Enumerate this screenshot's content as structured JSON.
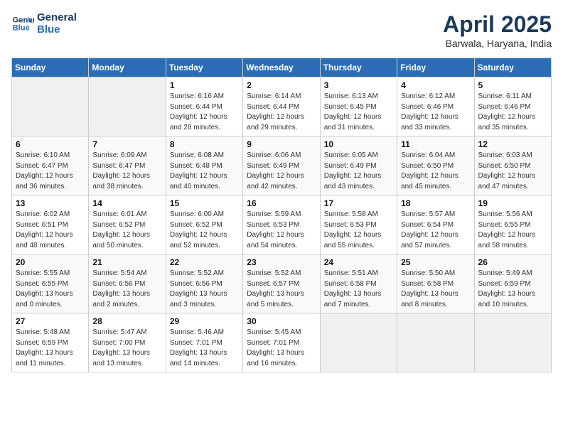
{
  "header": {
    "logo_line1": "General",
    "logo_line2": "Blue",
    "title": "April 2025",
    "subtitle": "Barwala, Haryana, India"
  },
  "calendar": {
    "days_of_week": [
      "Sunday",
      "Monday",
      "Tuesday",
      "Wednesday",
      "Thursday",
      "Friday",
      "Saturday"
    ],
    "weeks": [
      [
        {
          "num": "",
          "detail": ""
        },
        {
          "num": "",
          "detail": ""
        },
        {
          "num": "1",
          "detail": "Sunrise: 6:16 AM\nSunset: 6:44 PM\nDaylight: 12 hours\nand 28 minutes."
        },
        {
          "num": "2",
          "detail": "Sunrise: 6:14 AM\nSunset: 6:44 PM\nDaylight: 12 hours\nand 29 minutes."
        },
        {
          "num": "3",
          "detail": "Sunrise: 6:13 AM\nSunset: 6:45 PM\nDaylight: 12 hours\nand 31 minutes."
        },
        {
          "num": "4",
          "detail": "Sunrise: 6:12 AM\nSunset: 6:46 PM\nDaylight: 12 hours\nand 33 minutes."
        },
        {
          "num": "5",
          "detail": "Sunrise: 6:11 AM\nSunset: 6:46 PM\nDaylight: 12 hours\nand 35 minutes."
        }
      ],
      [
        {
          "num": "6",
          "detail": "Sunrise: 6:10 AM\nSunset: 6:47 PM\nDaylight: 12 hours\nand 36 minutes."
        },
        {
          "num": "7",
          "detail": "Sunrise: 6:09 AM\nSunset: 6:47 PM\nDaylight: 12 hours\nand 38 minutes."
        },
        {
          "num": "8",
          "detail": "Sunrise: 6:08 AM\nSunset: 6:48 PM\nDaylight: 12 hours\nand 40 minutes."
        },
        {
          "num": "9",
          "detail": "Sunrise: 6:06 AM\nSunset: 6:49 PM\nDaylight: 12 hours\nand 42 minutes."
        },
        {
          "num": "10",
          "detail": "Sunrise: 6:05 AM\nSunset: 6:49 PM\nDaylight: 12 hours\nand 43 minutes."
        },
        {
          "num": "11",
          "detail": "Sunrise: 6:04 AM\nSunset: 6:50 PM\nDaylight: 12 hours\nand 45 minutes."
        },
        {
          "num": "12",
          "detail": "Sunrise: 6:03 AM\nSunset: 6:50 PM\nDaylight: 12 hours\nand 47 minutes."
        }
      ],
      [
        {
          "num": "13",
          "detail": "Sunrise: 6:02 AM\nSunset: 6:51 PM\nDaylight: 12 hours\nand 48 minutes."
        },
        {
          "num": "14",
          "detail": "Sunrise: 6:01 AM\nSunset: 6:52 PM\nDaylight: 12 hours\nand 50 minutes."
        },
        {
          "num": "15",
          "detail": "Sunrise: 6:00 AM\nSunset: 6:52 PM\nDaylight: 12 hours\nand 52 minutes."
        },
        {
          "num": "16",
          "detail": "Sunrise: 5:59 AM\nSunset: 6:53 PM\nDaylight: 12 hours\nand 54 minutes."
        },
        {
          "num": "17",
          "detail": "Sunrise: 5:58 AM\nSunset: 6:53 PM\nDaylight: 12 hours\nand 55 minutes."
        },
        {
          "num": "18",
          "detail": "Sunrise: 5:57 AM\nSunset: 6:54 PM\nDaylight: 12 hours\nand 57 minutes."
        },
        {
          "num": "19",
          "detail": "Sunrise: 5:56 AM\nSunset: 6:55 PM\nDaylight: 12 hours\nand 58 minutes."
        }
      ],
      [
        {
          "num": "20",
          "detail": "Sunrise: 5:55 AM\nSunset: 6:55 PM\nDaylight: 13 hours\nand 0 minutes."
        },
        {
          "num": "21",
          "detail": "Sunrise: 5:54 AM\nSunset: 6:56 PM\nDaylight: 13 hours\nand 2 minutes."
        },
        {
          "num": "22",
          "detail": "Sunrise: 5:52 AM\nSunset: 6:56 PM\nDaylight: 13 hours\nand 3 minutes."
        },
        {
          "num": "23",
          "detail": "Sunrise: 5:52 AM\nSunset: 6:57 PM\nDaylight: 13 hours\nand 5 minutes."
        },
        {
          "num": "24",
          "detail": "Sunrise: 5:51 AM\nSunset: 6:58 PM\nDaylight: 13 hours\nand 7 minutes."
        },
        {
          "num": "25",
          "detail": "Sunrise: 5:50 AM\nSunset: 6:58 PM\nDaylight: 13 hours\nand 8 minutes."
        },
        {
          "num": "26",
          "detail": "Sunrise: 5:49 AM\nSunset: 6:59 PM\nDaylight: 13 hours\nand 10 minutes."
        }
      ],
      [
        {
          "num": "27",
          "detail": "Sunrise: 5:48 AM\nSunset: 6:59 PM\nDaylight: 13 hours\nand 11 minutes."
        },
        {
          "num": "28",
          "detail": "Sunrise: 5:47 AM\nSunset: 7:00 PM\nDaylight: 13 hours\nand 13 minutes."
        },
        {
          "num": "29",
          "detail": "Sunrise: 5:46 AM\nSunset: 7:01 PM\nDaylight: 13 hours\nand 14 minutes."
        },
        {
          "num": "30",
          "detail": "Sunrise: 5:45 AM\nSunset: 7:01 PM\nDaylight: 13 hours\nand 16 minutes."
        },
        {
          "num": "",
          "detail": ""
        },
        {
          "num": "",
          "detail": ""
        },
        {
          "num": "",
          "detail": ""
        }
      ]
    ]
  }
}
